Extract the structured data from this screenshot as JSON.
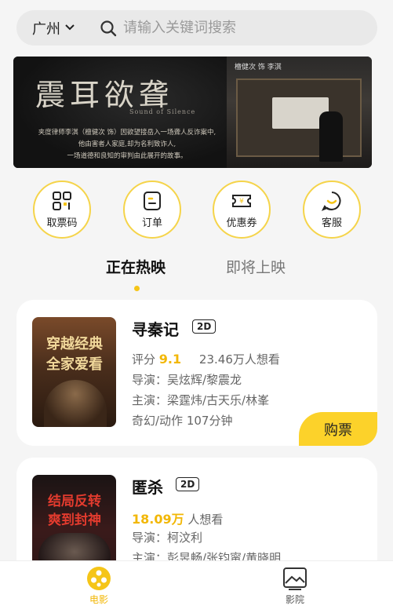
{
  "search": {
    "city": "广州",
    "placeholder": "请输入关键词搜索"
  },
  "banner": {
    "title": "震耳欲聋",
    "subtitle_en": "Sound of Silence",
    "lines": [
      "夹度律师李淇（檀健次 饰）因欲望接岳入一场聋人反诈案中,",
      "他由害者人家庭,却为名利致诈人,",
      "一场道德和良知的审判由此展开的故事。"
    ],
    "credits": "檀健次 饰 李淇"
  },
  "actions": [
    {
      "label": "取票码",
      "icon": "ticket-code-icon"
    },
    {
      "label": "订单",
      "icon": "order-icon"
    },
    {
      "label": "优惠券",
      "icon": "coupon-icon"
    },
    {
      "label": "客服",
      "icon": "customer-service-icon"
    }
  ],
  "tabs": {
    "now_showing": "正在热映",
    "coming_soon": "即将上映"
  },
  "movies": [
    {
      "title": "寻秦记",
      "format": "2D",
      "score_label": "评分",
      "score": "9.1",
      "want": "23.46万人想看",
      "director": "导演：吴炫辉/黎震龙",
      "cast": "主演：梁霆炜/古天乐/林峯",
      "genre": "奇幻/动作 107分钟",
      "buy_label": "购票",
      "poster_text": [
        "穿越经典",
        "全家爱看"
      ]
    },
    {
      "title": "匿杀",
      "format": "2D",
      "want_count": "18.09万",
      "want_suffix": "人想看",
      "director": "导演：柯汶利",
      "cast": "主演：彭昱畅/张钧甯/黄晓明",
      "poster_text": [
        "结局反转",
        "爽到封神"
      ]
    }
  ],
  "bottom_nav": {
    "movies": "电影",
    "cinemas": "影院"
  },
  "colors": {
    "accent": "#fcd22a",
    "score": "#f2b705"
  }
}
